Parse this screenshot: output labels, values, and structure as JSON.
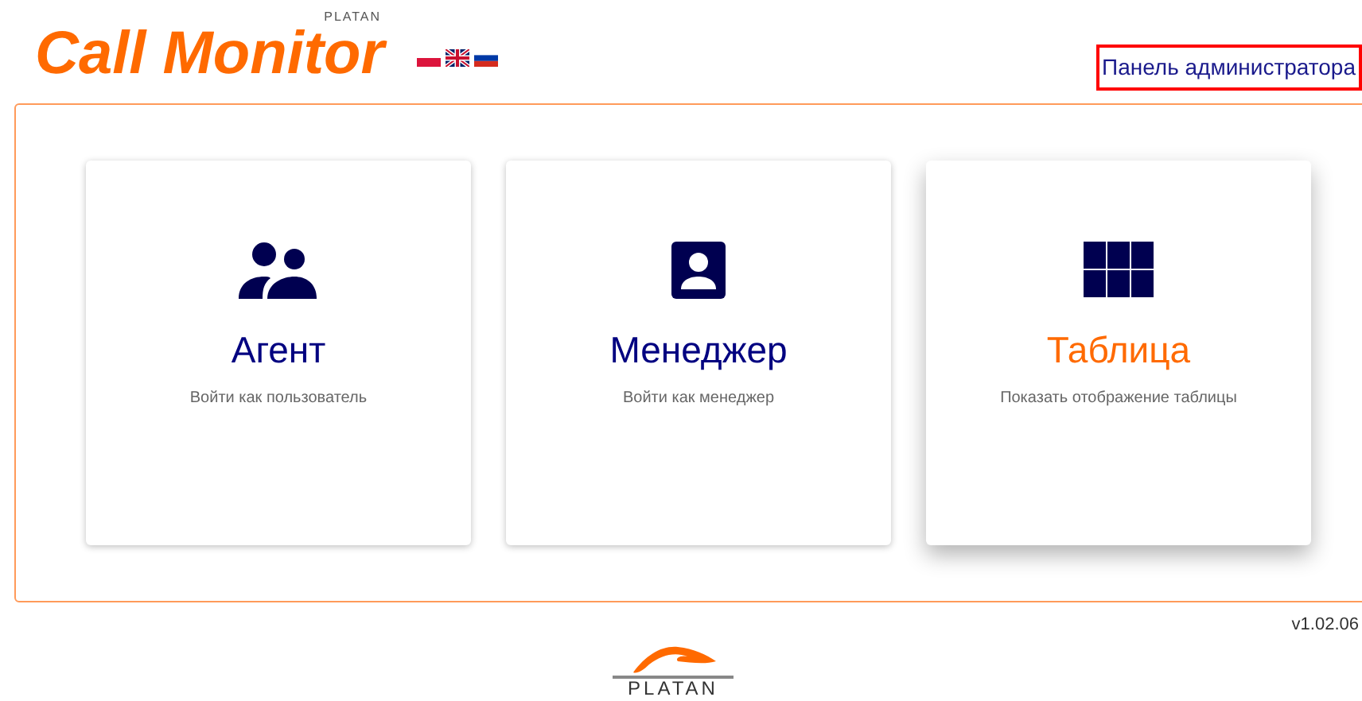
{
  "header": {
    "logo": "Call Monitor",
    "logo_brand": "PLATAN",
    "admin_link": "Панель администратора"
  },
  "cards": [
    {
      "kind": "people",
      "title": "Агент",
      "subtitle": "Войти как пользователь",
      "selected": false
    },
    {
      "kind": "person",
      "title": "Менеджер",
      "subtitle": "Войти как менеджер",
      "selected": false
    },
    {
      "kind": "grid",
      "title": "Таблица",
      "subtitle": "Показать отображение таблицы",
      "selected": true
    }
  ],
  "version": "v1.02.06",
  "footer": {
    "brand": "PLATAN"
  }
}
